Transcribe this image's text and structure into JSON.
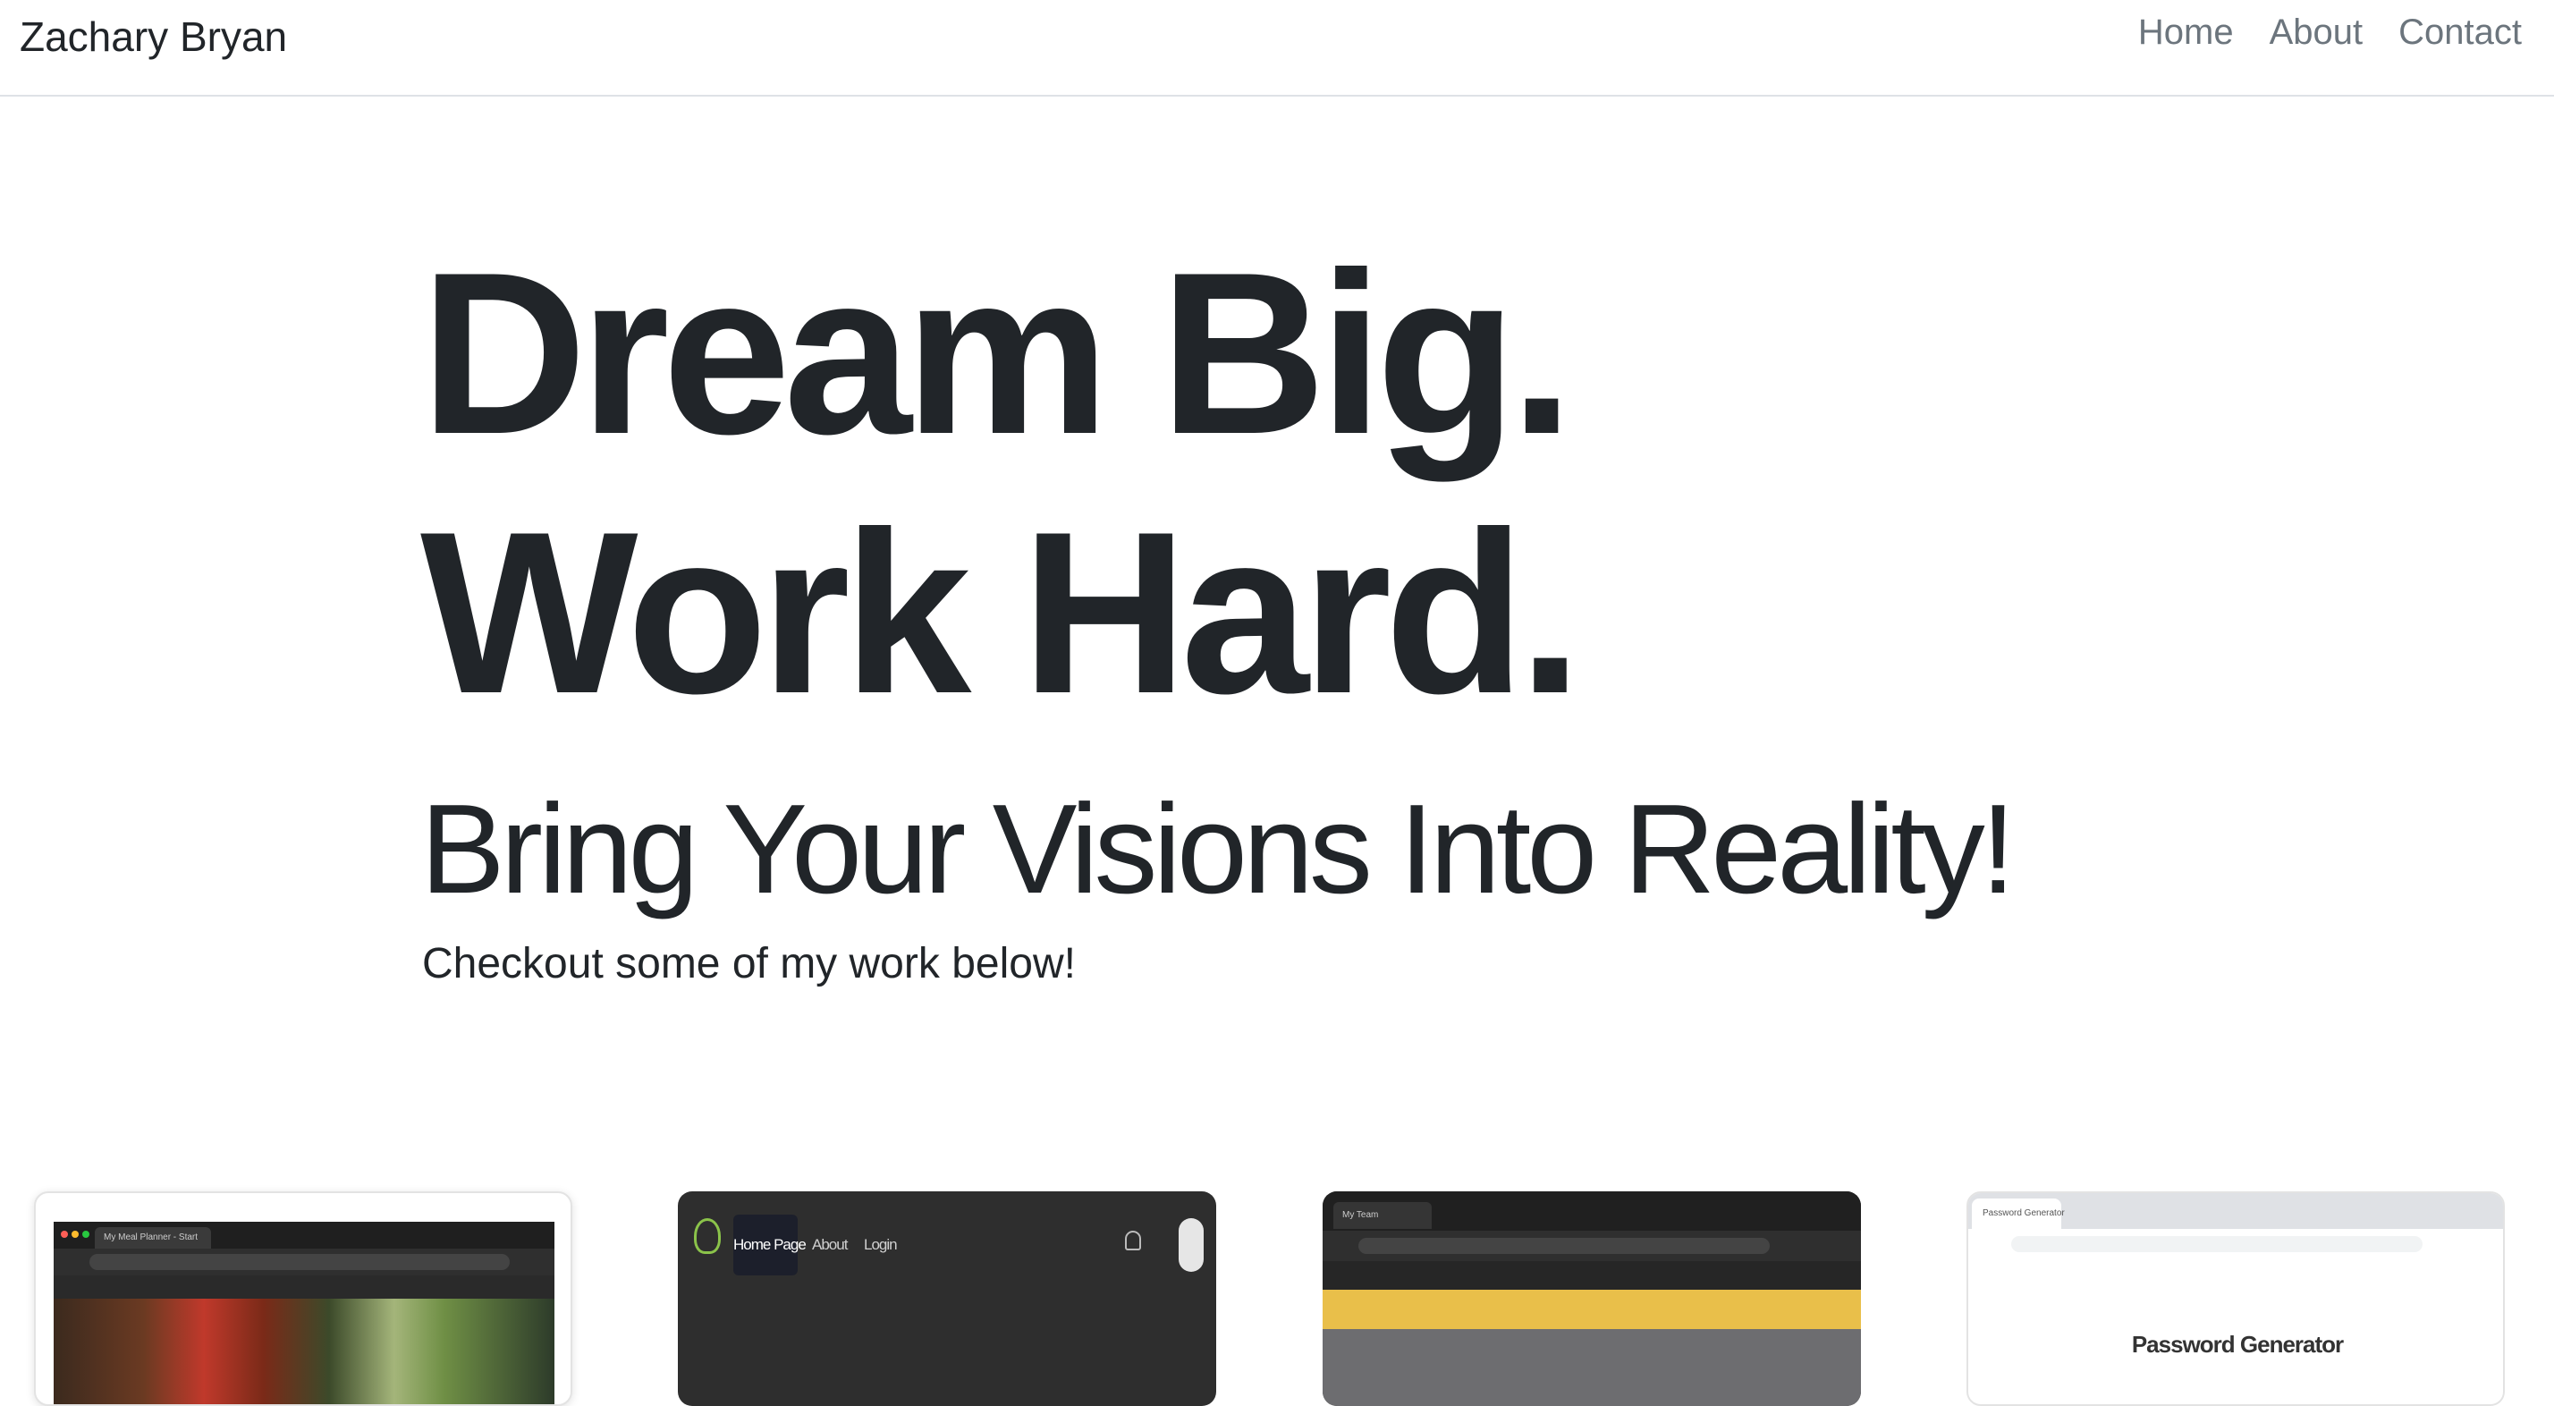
{
  "navbar": {
    "brand": "Zachary Bryan",
    "links": [
      {
        "label": "Home"
      },
      {
        "label": "About"
      },
      {
        "label": "Contact"
      }
    ]
  },
  "hero": {
    "title": "Dream Big. Work Hard.",
    "subtitle": "Bring Your Visions Into Reality!",
    "lead": "Checkout some of my work below!"
  },
  "projects": [
    {
      "thumbnail": "meal-planner-browser-screenshot",
      "tab_text": "My Meal Planner - Start"
    },
    {
      "thumbnail": "dark-app-home-screenshot",
      "nav": [
        "Home Page",
        "About",
        "Login"
      ]
    },
    {
      "thumbnail": "yellow-header-browser-screenshot",
      "tab_text": "My Team"
    },
    {
      "thumbnail": "password-generator-screenshot",
      "tab_text": "Password Generator",
      "page_title": "Password Generator"
    }
  ],
  "colors": {
    "text": "#212529",
    "nav_link": "#6c757d",
    "divider": "#dee2e6"
  }
}
